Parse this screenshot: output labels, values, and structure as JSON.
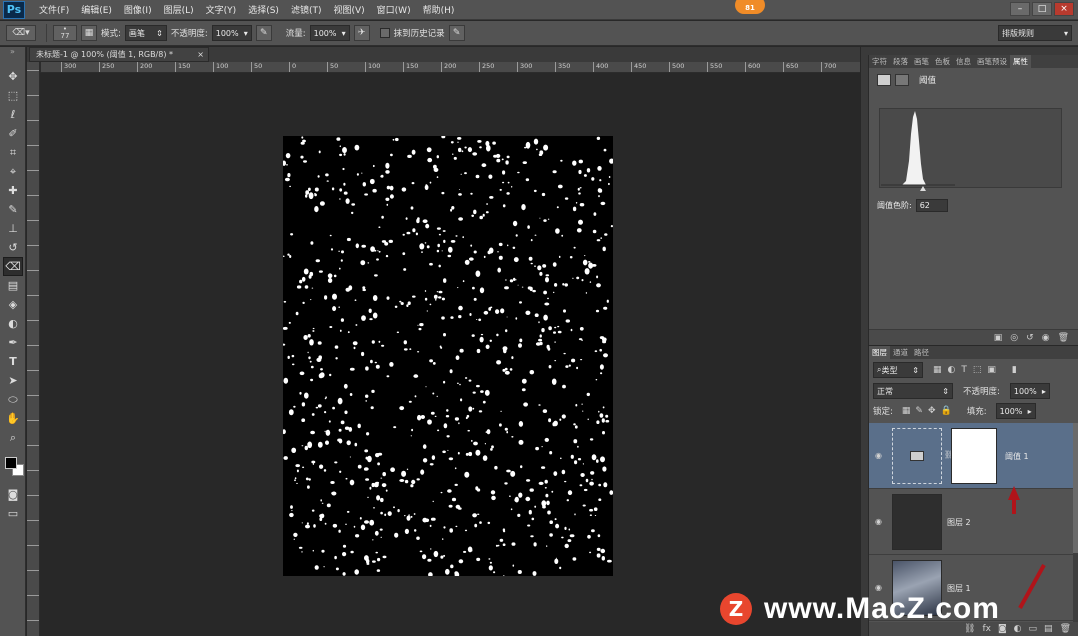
{
  "app": {
    "logo": "Ps",
    "notify_count": "81"
  },
  "menu": [
    "文件(F)",
    "编辑(E)",
    "图像(I)",
    "图层(L)",
    "文字(Y)",
    "选择(S)",
    "滤镜(T)",
    "视图(V)",
    "窗口(W)",
    "帮助(H)"
  ],
  "options": {
    "brush_size": "77",
    "mode_label": "模式:",
    "mode_value": "画笔",
    "opacity_label": "不透明度:",
    "opacity_value": "100%",
    "flow_label": "流量:",
    "flow_value": "100%",
    "erase_history_label": "抹到历史记录",
    "workspace_value": "排版规则"
  },
  "document": {
    "tab_title": "未标题-1 @ 100% (阈值 1, RGB/8) *",
    "close": "×"
  },
  "ruler": {
    "h_ticks": [
      "300",
      "250",
      "200",
      "150",
      "100",
      "50",
      "0",
      "50",
      "100",
      "150",
      "200",
      "250",
      "300",
      "350",
      "400",
      "450",
      "500",
      "550",
      "600",
      "650",
      "700"
    ]
  },
  "properties": {
    "tabs": [
      "字符",
      "段落",
      "画笔",
      "色板",
      "信息",
      "画笔预设",
      "属性"
    ],
    "adjustment_name": "阈值",
    "level_label": "阈值色阶:",
    "level_value": "62"
  },
  "layers_panel": {
    "tabs": [
      "图层",
      "通道",
      "路径"
    ],
    "filter_kind": "类型",
    "blend_mode": "正常",
    "opacity_label": "不透明度:",
    "opacity_value": "100%",
    "lock_label": "锁定:",
    "fill_label": "填充:",
    "fill_value": "100%",
    "layers": [
      {
        "name": "阈值 1",
        "selected": true
      },
      {
        "name": "图层 2",
        "selected": false
      },
      {
        "name": "图层 1",
        "selected": false
      }
    ]
  },
  "watermark": {
    "logo": "Z",
    "text": "www.MacZ.com"
  },
  "colors": {
    "accent": "#f08c28",
    "selected_layer": "#5a6f8a",
    "panel": "#535353"
  }
}
